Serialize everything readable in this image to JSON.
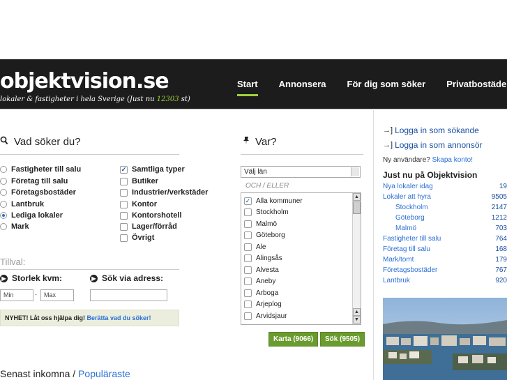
{
  "header": {
    "logo": "objektvision.se",
    "tagline_prefix": "lokaler & fastigheter i hela Sverige (Just nu ",
    "tagline_count": "12303",
    "tagline_suffix": " st)",
    "nav": [
      "Start",
      "Annonsera",
      "För dig som söker",
      "Privatbostäder"
    ],
    "active_nav": "Start",
    "accent_color": "#9fd23a"
  },
  "search": {
    "title": "Vad söker du?",
    "radios": [
      "Fastigheter till salu",
      "Företag till salu",
      "Företagsbostäder",
      "Lantbruk",
      "Lediga lokaler",
      "Mark"
    ],
    "selected_radio": "Lediga lokaler",
    "checkboxes": [
      "Samtliga typer",
      "Butiker",
      "Industrier/verkstäder",
      "Kontor",
      "Kontorshotell",
      "Lager/förråd",
      "Övrigt"
    ],
    "checked": [
      "Samtliga typer"
    ],
    "tillval": "Tillval:",
    "size_label": "Storlek kvm:",
    "min_placeholder": "Min",
    "max_placeholder": "Max",
    "range_sep": "-",
    "address_label": "Sök via adress:",
    "news_prefix": "NYHET! Låt oss hjälpa dig! ",
    "news_link": "Berätta vad du söker!"
  },
  "where": {
    "title": "Var?",
    "select_value": "Välj län",
    "or_label": "OCH / ELLER",
    "municipalities": [
      "Alla kommuner",
      "Stockholm",
      "Malmö",
      "Göteborg",
      "Ale",
      "Alingsås",
      "Alvesta",
      "Aneby",
      "Arboga",
      "Arjeplog",
      "Arvidsjaur"
    ],
    "checked": [
      "Alla kommuner"
    ],
    "map_button": "Karta (9066)",
    "search_button": "Sök (9505)"
  },
  "latest": {
    "prefix": "Senast inkomna",
    "sep": " / ",
    "link": "Populäraste"
  },
  "sidebar": {
    "login_seeker": "Logga in som sökande",
    "login_advertiser": "Logga in som annonsör",
    "new_user_text": "Ny användare? ",
    "create_account": "Skapa konto!",
    "just_now_title": "Just nu på Objektvision",
    "stats": [
      {
        "label": "Nya lokaler idag",
        "value": "19",
        "indent": false
      },
      {
        "label": "Lokaler att hyra",
        "value": "9505",
        "indent": false
      },
      {
        "label": "Stockholm",
        "value": "2147",
        "indent": true
      },
      {
        "label": "Göteborg",
        "value": "1212",
        "indent": true
      },
      {
        "label": "Malmö",
        "value": "703",
        "indent": true
      },
      {
        "label": "Fastigheter till salu",
        "value": "764",
        "indent": false
      },
      {
        "label": "Företag till salu",
        "value": "168",
        "indent": false
      },
      {
        "label": "Mark/tomt",
        "value": "179",
        "indent": false
      },
      {
        "label": "Företagsbostäder",
        "value": "767",
        "indent": false
      },
      {
        "label": "Lantbruk",
        "value": "920",
        "indent": false
      }
    ]
  }
}
